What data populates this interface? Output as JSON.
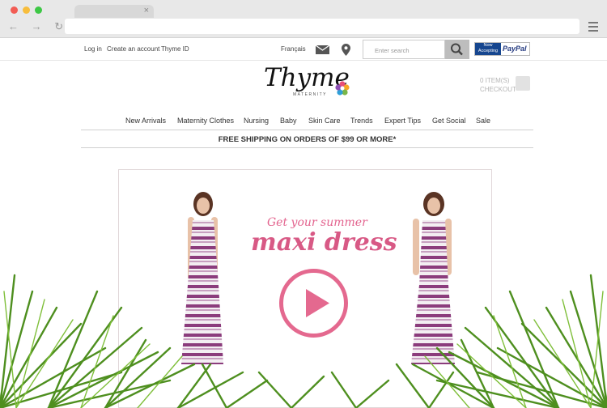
{
  "browser": {
    "tab_close": "×",
    "nav_arrows": "← → ↻"
  },
  "topbar": {
    "links": [
      "Log in",
      "Create an account",
      "Thyme ID"
    ],
    "language": "Français",
    "search_placeholder": "Enter search",
    "paypal_badge": {
      "line1": "Now",
      "line2": "Accepting",
      "brand": "PayPal"
    }
  },
  "logo": {
    "name": "Thyme",
    "subtitle": "MATERNITY"
  },
  "cart": {
    "items": "0 ITEM(S)",
    "checkout": "CHECKOUT"
  },
  "nav": {
    "items": [
      "New Arrivals",
      "Maternity Clothes",
      "Nursing",
      "Baby",
      "Skin Care",
      "Trends",
      "Expert Tips",
      "Get Social",
      "Sale"
    ]
  },
  "promo": {
    "shipping": "FREE SHIPPING ON ORDERS OF $99 OR MORE*"
  },
  "hero": {
    "line1": "Get your summer",
    "line2": "maxi dress"
  },
  "icons": {
    "mail": "envelope-icon",
    "location": "map-pin-icon",
    "search": "magnifier-icon",
    "cart": "shopping-bag-icon",
    "play": "play-icon"
  },
  "colors": {
    "accent_pink": "#d85985",
    "paypal_blue": "#253b80",
    "leaf_green": "#4e8f1f"
  }
}
